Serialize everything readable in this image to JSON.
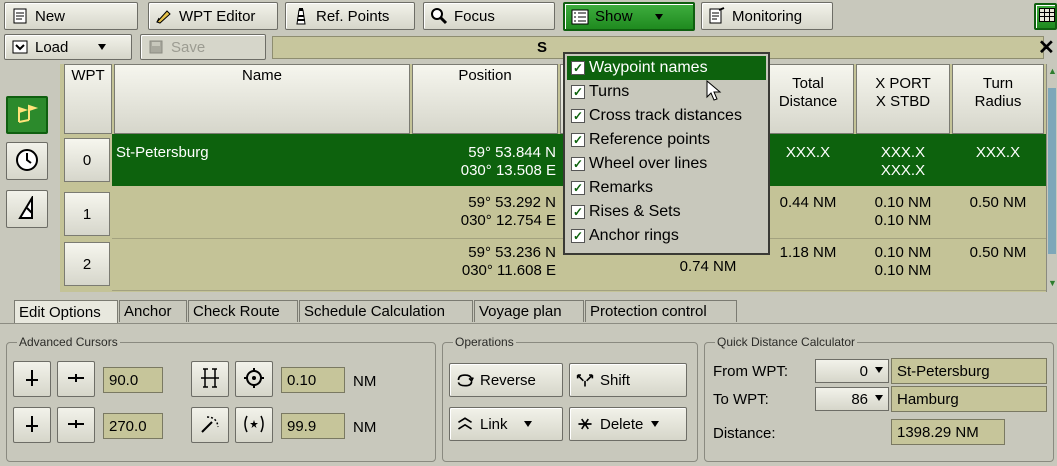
{
  "toolbar": {
    "new_label": "New",
    "wpt_editor_label": "WPT Editor",
    "ref_points_label": "Ref. Points",
    "focus_label": "Focus",
    "show_label": "Show",
    "monitoring_label": "Monitoring",
    "load_label": "Load",
    "save_label": "Save",
    "title_letter": "S",
    "close_label": "✕"
  },
  "table": {
    "headers": {
      "wpt": "WPT",
      "name": "Name",
      "position": "Position",
      "total_distance": "Total\nDistance",
      "xport_xstbd": "X PORT\nX STBD",
      "turn_radius": "Turn\nRadius"
    },
    "rows": [
      {
        "num": "0",
        "name": "St-Petersburg",
        "lat": "59° 53.844 N",
        "lon": "030° 13.508 E",
        "total": "XXX.X",
        "xport": "XXX.X",
        "xstbd": "XXX.X",
        "radius": "XXX.X",
        "mid": ""
      },
      {
        "num": "1",
        "name": "",
        "lat": "59° 53.292 N",
        "lon": "030° 12.754 E",
        "total": "0.44 NM",
        "xport": "0.10 NM",
        "xstbd": "0.10 NM",
        "radius": "0.50 NM",
        "mid": ""
      },
      {
        "num": "2",
        "name": "",
        "lat": "59° 53.236 N",
        "lon": "030° 11.608 E",
        "total": "1.18 NM",
        "xport": "0.10 NM",
        "xstbd": "0.10 NM",
        "radius": "0.50 NM",
        "mid": "0.74 NM"
      }
    ]
  },
  "show_menu": {
    "items": [
      {
        "label": "Waypoint names",
        "checked": true,
        "highlighted": true
      },
      {
        "label": "Turns",
        "checked": true
      },
      {
        "label": "Cross track distances",
        "checked": true
      },
      {
        "label": "Reference points",
        "checked": true
      },
      {
        "label": "Wheel over lines",
        "checked": true
      },
      {
        "label": "Remarks",
        "checked": true
      },
      {
        "label": "Rises & Sets",
        "checked": true
      },
      {
        "label": "Anchor rings",
        "checked": true
      }
    ]
  },
  "tabs": [
    {
      "label": "Edit Options",
      "active": true
    },
    {
      "label": "Anchor"
    },
    {
      "label": "Check Route"
    },
    {
      "label": "Schedule Calculation"
    },
    {
      "label": "Voyage plan"
    },
    {
      "label": "Protection control"
    }
  ],
  "advanced_cursors": {
    "legend": "Advanced Cursors",
    "angle1": "90.0",
    "angle2": "270.0",
    "dist1": "0.10",
    "dist2": "99.9",
    "unit": "NM"
  },
  "operations": {
    "legend": "Operations",
    "reverse_label": "Reverse",
    "shift_label": "Shift",
    "link_label": "Link",
    "delete_label": "Delete"
  },
  "quick_distance": {
    "legend": "Quick Distance Calculator",
    "from_label": "From WPT:",
    "to_label": "To WPT:",
    "distance_label": "Distance:",
    "from_wpt": "0",
    "to_wpt": "86",
    "from_name": "St-Petersburg",
    "to_name": "Hamburg",
    "distance_value": "1398.29 NM"
  },
  "colors": {
    "selection": "#0d620d",
    "accent_green": "#2c8a2c",
    "field_bg": "#c6c59a"
  }
}
